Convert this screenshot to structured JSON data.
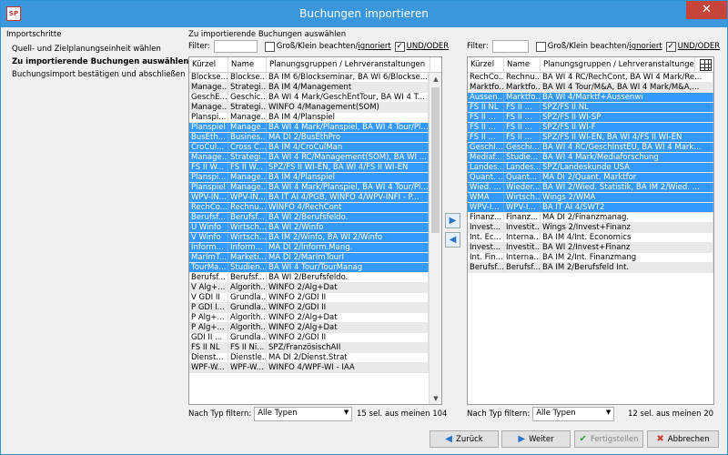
{
  "window": {
    "title": "Buchungen importieren",
    "app_icon": "SP",
    "close": "✕"
  },
  "nav": {
    "heading": "Importschritte",
    "items": [
      {
        "label": "Quell- und Zielplanungseinheit wählen",
        "bold": false
      },
      {
        "label": "Zu importierende Buchungen auswählen",
        "bold": true
      },
      {
        "label": "Buchungsimport bestätigen und abschließen",
        "bold": false
      }
    ]
  },
  "section_title": "Zu importierende Buchungen auswählen",
  "filter": {
    "label": "Filter:",
    "case_label": "Groß/Klein beachten/",
    "ignore_label": "ignoriert",
    "and_or_label": "UND/ODER",
    "and_or_check": "✓"
  },
  "columns": [
    "Kürzel",
    "Name",
    "Planungsgruppen / Lehrveranstaltungen"
  ],
  "left_rows": [
    {
      "k": "Blockse...",
      "n": "Blockse...",
      "p": "BA IM 6/Blockseminar, BA WI 6/Blockse...",
      "s": false
    },
    {
      "k": "Manage...",
      "n": "Strategi...",
      "p": "BA IM 4/Management",
      "s": false
    },
    {
      "k": "GeschE...",
      "n": "Geschic...",
      "p": "BA WI 4 Mark/GeschEntTour, BA WI 4 T...",
      "s": false
    },
    {
      "k": "Manage...",
      "n": "Strategi...",
      "p": "WINFO 4/Management(SOM)",
      "s": false
    },
    {
      "k": "Planspi...",
      "n": "Manage...",
      "p": "BA IM 4/Planspiel",
      "s": false
    },
    {
      "k": "Planspiel",
      "n": "Manage...",
      "p": "BA WI 4 Mark/Planspiel, BA WI 4 Tour/Pl...",
      "s": true
    },
    {
      "k": "BusEth...",
      "n": "Busines...",
      "p": "MA DI 2/BusEthPro",
      "s": true
    },
    {
      "k": "CroCul...",
      "n": "Cross C...",
      "p": "BA IM 4/CroCulMan",
      "s": true
    },
    {
      "k": "Manage...",
      "n": "Strategi...",
      "p": "BA WI 4 RC/Management(SOM), BA WI ...",
      "s": true
    },
    {
      "k": "FS II W...",
      "n": "FS II W...",
      "p": "SPZ/FS II WI-EN, BA WI 4/FS II WI-EN",
      "s": true
    },
    {
      "k": "Planspi...",
      "n": "Manage...",
      "p": "BA IM 4/Planspiel",
      "s": true
    },
    {
      "k": "Planspiel",
      "n": "Manage...",
      "p": "BA WI 4 Mark/Planspiel, BA WI 4 Tour/Pl...",
      "s": true
    },
    {
      "k": "WPV-IN...",
      "n": "WPV-IN...",
      "p": "BA IT AI 4/PGB, WINFO 4/WPV-INFI - P...",
      "s": true
    },
    {
      "k": "RechCo...",
      "n": "Rechnu...",
      "p": "WINFO 4/RechCont",
      "s": true
    },
    {
      "k": "Berufsf...",
      "n": "Berufsf...",
      "p": "BA WI 2/Berufsfeldo.",
      "s": true
    },
    {
      "k": "Ü Winfo",
      "n": "Wirtsch...",
      "p": "BA WI 2/Winfo",
      "s": true
    },
    {
      "k": "V Winfo",
      "n": "Wirtsch...",
      "p": "BA IM 2/Winfo, BA WI 2/Winfo",
      "s": true
    },
    {
      "k": "Inform...",
      "n": "Inform...",
      "p": "MA DI 2/Inform.Mang.",
      "s": true
    },
    {
      "k": "MarImT...",
      "n": "Marketi...",
      "p": "MA DI 2/MarImTourI",
      "s": true
    },
    {
      "k": "TourMa...",
      "n": "Studien...",
      "p": "BA WI 4 Tour/TourManag",
      "s": true
    },
    {
      "k": "Berufsf...",
      "n": "Berufsf...",
      "p": "BA WI 2/Berufsfeldo.",
      "s": false
    },
    {
      "k": "V Alg+...",
      "n": "Algorith...",
      "p": "WINFO 2/Alg+Dat",
      "s": false
    },
    {
      "k": "V GDI II",
      "n": "Grundla...",
      "p": "WINFO 2/GDI II",
      "s": false
    },
    {
      "k": "P GDI I...",
      "n": "Grundla...",
      "p": "WINFO 2/GDI II",
      "s": false
    },
    {
      "k": "P Alg+...",
      "n": "Algorith...",
      "p": "WINFO 2/Alg+Dat",
      "s": false
    },
    {
      "k": "P Alg+...",
      "n": "Algorith...",
      "p": "WINFO 2/Alg+Dat",
      "s": false
    },
    {
      "k": "GDI II ...",
      "n": "Grundla...",
      "p": "WINFO 2/GDI II",
      "s": false
    },
    {
      "k": "FS II NL",
      "n": "FS II Ni...",
      "p": "SPZ/FranzösischAII",
      "s": false
    },
    {
      "k": "Dienst...",
      "n": "Dienstle...",
      "p": "MA DI 2/Dienst.Strat",
      "s": false
    },
    {
      "k": "WPF-W...",
      "n": "WPF-W...",
      "p": "WINFO 4/WPF-WI - IAA",
      "s": false
    }
  ],
  "right_rows": [
    {
      "k": "RechCo...",
      "n": "Rechnu...",
      "p": "BA WI 4 RC/RechCont, BA WI 4 Mark/Re...",
      "s": false
    },
    {
      "k": "Marktfo...",
      "n": "Marktfo...",
      "p": "BA WI 4 Tour/M&A, BA WI 4 Mark/M&A,...",
      "s": false
    },
    {
      "k": "Aussen...",
      "n": "Marktfo...",
      "p": "BA WI 4/Marktf+Aussenwi",
      "s": true
    },
    {
      "k": "FS II NL",
      "n": "FS II ...",
      "p": "SPZ/FS II NL",
      "s": true
    },
    {
      "k": "FS II ...",
      "n": "FS II ...",
      "p": "SPZ/FS II WI-SP",
      "s": true
    },
    {
      "k": "FS II ...",
      "n": "FS II ...",
      "p": "SPZ/FS II WI-F",
      "s": true
    },
    {
      "k": "FS II ...",
      "n": "FS II ...",
      "p": "SPZ/FS II WI-EN, BA WI 4/FS II WI-EN",
      "s": true
    },
    {
      "k": "GeschI...",
      "n": "Geschi...",
      "p": "BA WI 4 RC/GeschInstEU, BA WI 4 Mark...",
      "s": true
    },
    {
      "k": "Mediaf...",
      "n": "Studie...",
      "p": "BA WI 4 Mark/Mediaforschung",
      "s": true
    },
    {
      "k": "Landes...",
      "n": "Landes...",
      "p": "SPZ/Landeskunde USA",
      "s": true
    },
    {
      "k": "Quant. ...",
      "n": "Quant...",
      "p": "MA DI 2/Quant. Marktfor",
      "s": true
    },
    {
      "k": "Wied. ...",
      "n": "Wieder...",
      "p": "BA WI 2/Wied. Statistik, BA IM 2/Wied. ...",
      "s": true
    },
    {
      "k": "WMA",
      "n": "Wirtsch...",
      "p": "Wings 2/WMA",
      "s": true
    },
    {
      "k": "WPV-I...",
      "n": "WPV-I...",
      "p": "BA IT AI 4/SWT2",
      "s": true
    },
    {
      "k": "Finanz...",
      "n": "Finanz...",
      "p": "MA DI 2/Finanzmanag.",
      "s": false
    },
    {
      "k": "Invest...",
      "n": "Investit...",
      "p": "Wings 2/Invest+Finanz",
      "s": false
    },
    {
      "k": "Int. Ec...",
      "n": "Interna...",
      "p": "BA IM 4/Int. Economics",
      "s": false
    },
    {
      "k": "Invest...",
      "n": "Investit...",
      "p": "BA WI 2/Invest+Finanz",
      "s": false
    },
    {
      "k": "Int. Fin...",
      "n": "Interna...",
      "p": "BA IM 2/Int. Finanzmang",
      "s": false
    },
    {
      "k": "Berufsf...",
      "n": "Berufsf...",
      "p": "BA IM 2/Berufsfeld Int.",
      "s": false
    }
  ],
  "type_filter": {
    "label": "Nach Typ filtern:",
    "value": "Alle Typen"
  },
  "left_count": "15 sel. aus meinen 104",
  "right_count": "12 sel. aus meinen 20",
  "buttons": {
    "back": "Zurück",
    "next": "Weiter",
    "finish": "Fertigstellen",
    "cancel": "Abbrechen"
  },
  "icons": {
    "move_right": "▶",
    "move_left": "◀",
    "back": "◀",
    "next": "▶",
    "finish": "✔",
    "cancel": "✖",
    "scroll_up": "▲",
    "scroll_down": "▼",
    "chevron": "▼"
  },
  "colors": {
    "title_bar": "#3a97db",
    "selection": "#3399ff",
    "close": "#c7443a"
  }
}
